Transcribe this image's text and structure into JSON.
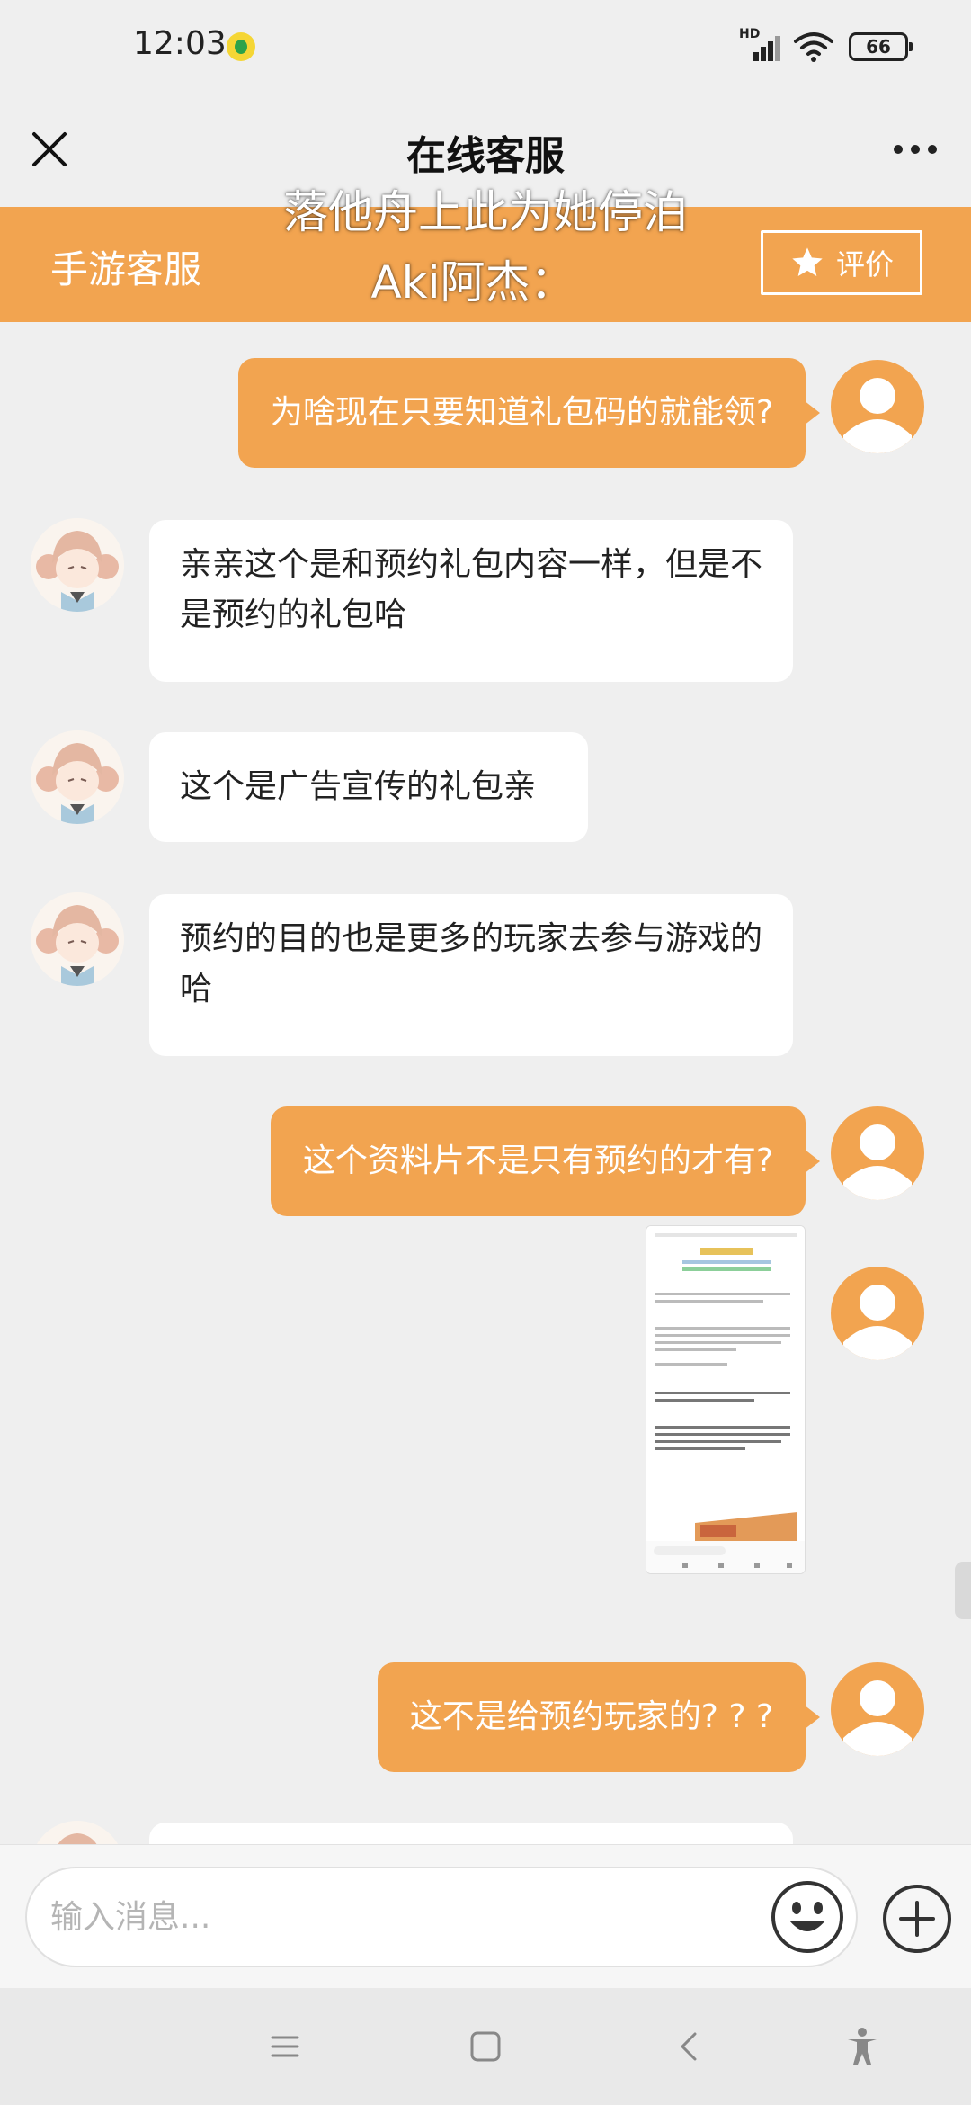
{
  "status_bar": {
    "time": "12:03",
    "network_label": "HD",
    "battery": "66"
  },
  "nav": {
    "title": "在线客服",
    "close_icon": "close-icon",
    "more_icon": "more-icon"
  },
  "service_header": {
    "name": "手游客服",
    "rate_label": "评价",
    "accent_color": "#f2a450"
  },
  "overlay_lyrics": {
    "line1": "落他舟上此为她停泊",
    "line2": "Aki阿杰："
  },
  "messages": [
    {
      "sender": "user",
      "type": "text",
      "text": "为啥现在只要知道礼包码的就能领?"
    },
    {
      "sender": "agent",
      "type": "text",
      "text": "亲亲这个是和预约礼包内容一样，但是不是预约的礼包哈"
    },
    {
      "sender": "agent",
      "type": "text",
      "text": "这个是广告宣传的礼包亲"
    },
    {
      "sender": "agent",
      "type": "text",
      "text": "预约的目的也是更多的玩家去参与游戏的哈"
    },
    {
      "sender": "user",
      "type": "text",
      "text": "这个资料片不是只有预约的才有?"
    },
    {
      "sender": "user",
      "type": "image",
      "text": ""
    },
    {
      "sender": "user",
      "type": "text",
      "text": "这不是给预约玩家的? ? ?"
    }
  ],
  "input": {
    "placeholder": "输入消息..."
  }
}
